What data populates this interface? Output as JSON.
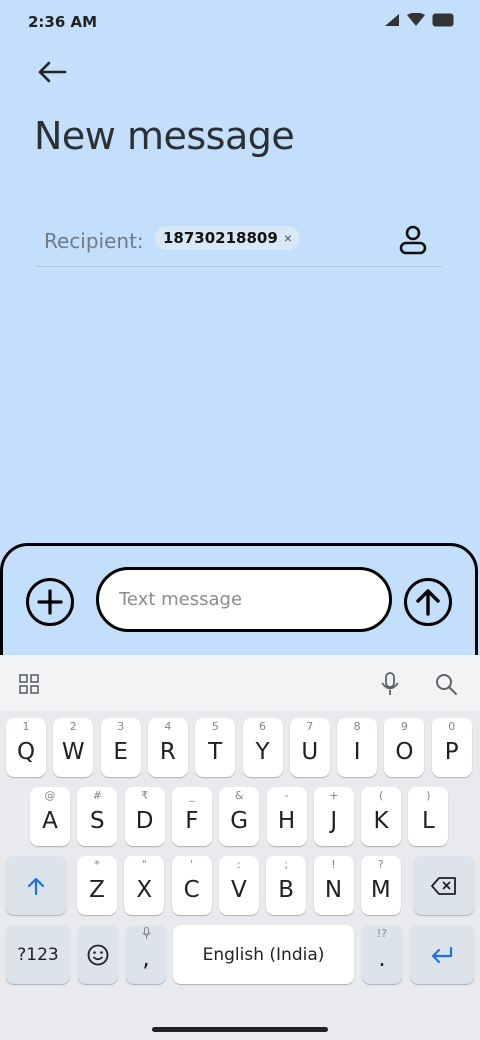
{
  "status_bar": {
    "time": "2:36 AM"
  },
  "header": {
    "title": "New message"
  },
  "recipient": {
    "label": "Recipient:",
    "chip_number": "18730218809",
    "chip_remove": "×"
  },
  "composer": {
    "placeholder": "Text message"
  },
  "keyboard": {
    "row1": [
      {
        "hint": "1",
        "key": "Q"
      },
      {
        "hint": "2",
        "key": "W"
      },
      {
        "hint": "3",
        "key": "E"
      },
      {
        "hint": "4",
        "key": "R"
      },
      {
        "hint": "5",
        "key": "T"
      },
      {
        "hint": "6",
        "key": "Y"
      },
      {
        "hint": "7",
        "key": "U"
      },
      {
        "hint": "8",
        "key": "I"
      },
      {
        "hint": "9",
        "key": "O"
      },
      {
        "hint": "0",
        "key": "P"
      }
    ],
    "row2": [
      {
        "hint": "@",
        "key": "A"
      },
      {
        "hint": "#",
        "key": "S"
      },
      {
        "hint": "₹",
        "key": "D"
      },
      {
        "hint": "_",
        "key": "F"
      },
      {
        "hint": "&",
        "key": "G"
      },
      {
        "hint": "-",
        "key": "H"
      },
      {
        "hint": "+",
        "key": "J"
      },
      {
        "hint": "(",
        "key": "K"
      },
      {
        "hint": ")",
        "key": "L"
      }
    ],
    "row3": [
      {
        "hint": "*",
        "key": "Z"
      },
      {
        "hint": "\"",
        "key": "X"
      },
      {
        "hint": "'",
        "key": "C"
      },
      {
        "hint": ":",
        "key": "V"
      },
      {
        "hint": ";",
        "key": "B"
      },
      {
        "hint": "!",
        "key": "N"
      },
      {
        "hint": "?",
        "key": "M"
      }
    ],
    "symbols_label": "?123",
    "comma": ",",
    "space_label": "English (India)",
    "period": ".",
    "period_hint": "!?"
  },
  "colors": {
    "background": "#c4dffb",
    "accent": "#1a73e8"
  }
}
